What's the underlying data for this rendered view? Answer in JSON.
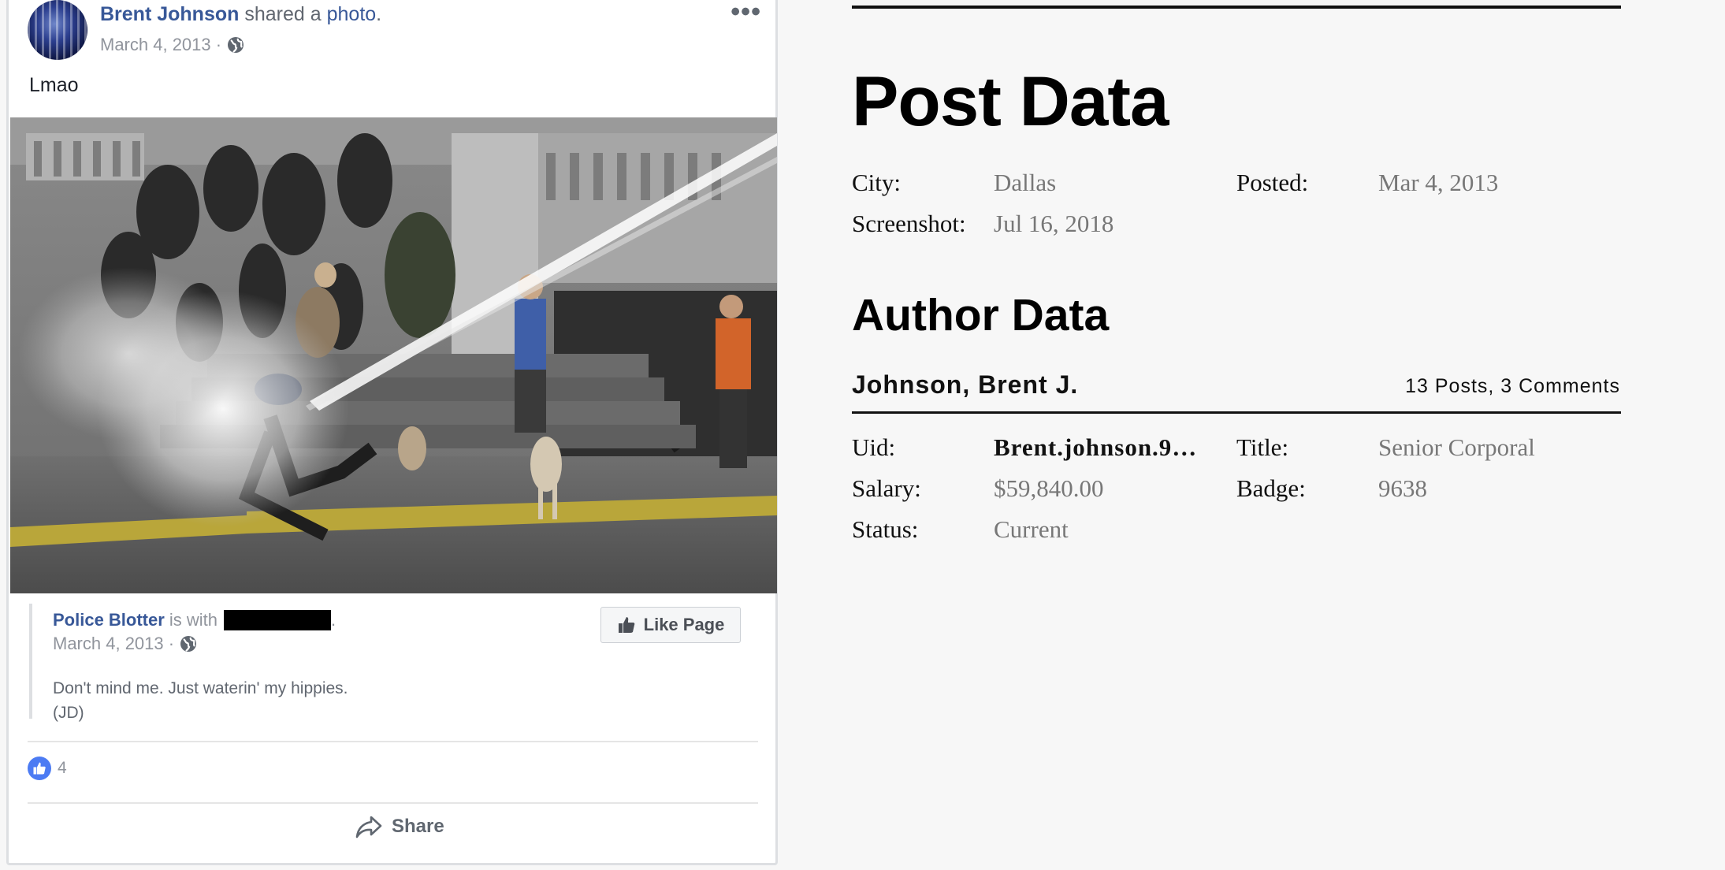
{
  "post": {
    "author": "Brent Johnson",
    "shared_text": "shared a",
    "shared_link": "photo",
    "date": "March 4, 2013 ·",
    "text": "Lmao",
    "menu_icon": "more-icon"
  },
  "shared_post": {
    "page_name": "Police Blotter",
    "with_text": "is with",
    "date": "March 4, 2013 ·",
    "text": "Don't mind me. Just waterin' my hippies.\n(JD)",
    "like_page_label": "Like Page"
  },
  "reactions": {
    "count": "4"
  },
  "actions": {
    "share_label": "Share"
  },
  "post_data": {
    "title": "Post Data",
    "city_label": "City:",
    "city": "Dallas",
    "posted_label": "Posted:",
    "posted": "Mar 4, 2013",
    "screenshot_label": "Screenshot:",
    "screenshot": "Jul 16, 2018"
  },
  "author_data": {
    "title": "Author Data",
    "name": "Johnson, Brent J.",
    "stats": "13 Posts, 3 Comments",
    "uid_label": "Uid:",
    "uid": "Brent.johnson.9…",
    "title_label": "Title:",
    "rank": "Senior Corporal",
    "salary_label": "Salary:",
    "salary": "$59,840.00",
    "badge_label": "Badge:",
    "badge": "9638",
    "status_label": "Status:",
    "status": "Current"
  },
  "colors": {
    "fb_link": "#385898",
    "fb_muted": "#90949c",
    "like_blue": "#4c7bf3"
  }
}
